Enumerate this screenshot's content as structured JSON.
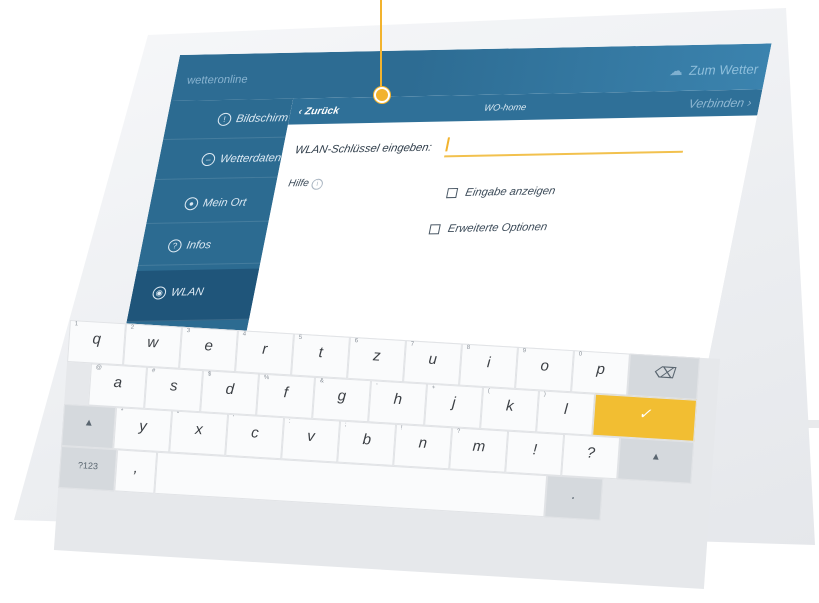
{
  "app": {
    "brand": "wetteronline",
    "to_weather": "Zum Wetter"
  },
  "sidebar": {
    "items": [
      {
        "label": "Bildschirm",
        "icon": "info-circle-icon",
        "glyph": "!"
      },
      {
        "label": "Wetterdaten",
        "icon": "minus-circle-icon",
        "glyph": "–"
      },
      {
        "label": "Mein Ort",
        "icon": "location-pin-icon",
        "glyph": "●"
      },
      {
        "label": "Infos",
        "icon": "question-circle-icon",
        "glyph": "?"
      },
      {
        "label": "WLAN",
        "icon": "wifi-icon",
        "glyph": "◉",
        "active": true
      }
    ]
  },
  "panel": {
    "back": "Zurück",
    "ssid": "WO-home",
    "connect": "Verbinden",
    "key_label": "WLAN-Schlüssel eingeben:",
    "key_value": "",
    "help": "Hilfe",
    "show_input": "Eingabe anzeigen",
    "advanced": "Erweiterte Optionen"
  },
  "keyboard": {
    "row1": [
      {
        "k": "q",
        "n": "1"
      },
      {
        "k": "w",
        "n": "2"
      },
      {
        "k": "e",
        "n": "3"
      },
      {
        "k": "r",
        "n": "4"
      },
      {
        "k": "t",
        "n": "5"
      },
      {
        "k": "z",
        "n": "6"
      },
      {
        "k": "u",
        "n": "7"
      },
      {
        "k": "i",
        "n": "8"
      },
      {
        "k": "o",
        "n": "9"
      },
      {
        "k": "p",
        "n": "0"
      }
    ],
    "row2": [
      {
        "k": "a",
        "n": "@"
      },
      {
        "k": "s",
        "n": "#"
      },
      {
        "k": "d",
        "n": "$"
      },
      {
        "k": "f",
        "n": "%"
      },
      {
        "k": "g",
        "n": "&"
      },
      {
        "k": "h",
        "n": "-"
      },
      {
        "k": "j",
        "n": "+"
      },
      {
        "k": "k",
        "n": "("
      },
      {
        "k": "l",
        "n": ")"
      }
    ],
    "row3": [
      {
        "k": "y",
        "n": "*"
      },
      {
        "k": "x",
        "n": "\""
      },
      {
        "k": "c",
        "n": "'"
      },
      {
        "k": "v",
        "n": ":"
      },
      {
        "k": "b",
        "n": ";"
      },
      {
        "k": "n",
        "n": "!"
      },
      {
        "k": "m",
        "n": "?"
      },
      {
        "k": "!",
        "n": ""
      },
      {
        "k": "?",
        "n": ""
      }
    ],
    "numeric": "?123",
    "comma": ",",
    "period": ".",
    "backspace_glyph": "⌫",
    "shift_glyph": "▲",
    "enter_glyph": "✓"
  },
  "colors": {
    "primary": "#2c6b91",
    "accent": "#f2be32",
    "device": "#eceef1"
  }
}
